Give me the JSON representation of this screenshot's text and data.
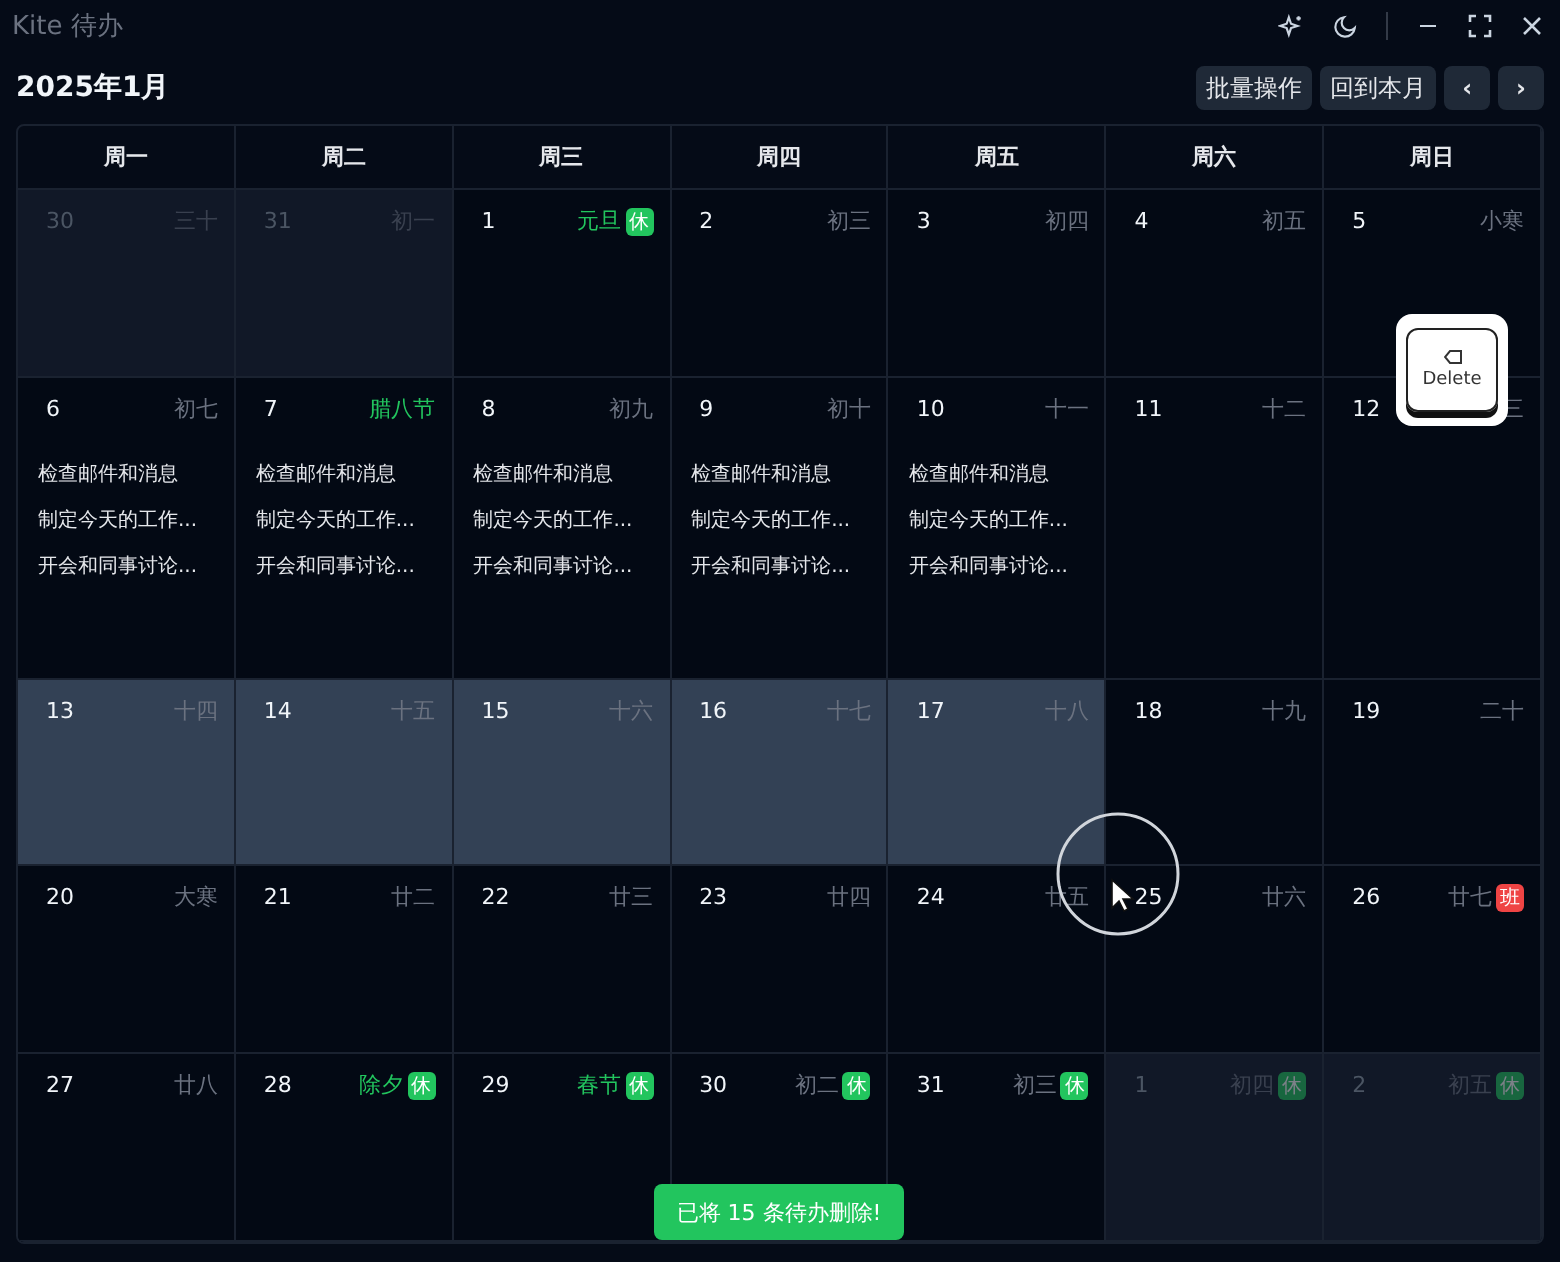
{
  "window": {
    "title": "Kite 待办"
  },
  "month_title": "2025年1月",
  "toolbar": [
    {
      "label": "批量操作",
      "kind": "text"
    },
    {
      "label": "回到本月",
      "kind": "text"
    },
    {
      "label": "‹",
      "kind": "icon"
    },
    {
      "label": "›",
      "kind": "icon"
    }
  ],
  "weekdays": [
    "周一",
    "周二",
    "周三",
    "周四",
    "周五",
    "周六",
    "周日"
  ],
  "weeks": [
    {
      "days": [
        {
          "day": "30",
          "lunar": "三十",
          "festival": false,
          "other_month": true,
          "selected": false
        },
        {
          "day": "31",
          "lunar": "初一",
          "festival": false,
          "other_month": true,
          "selected": false
        },
        {
          "day": "1",
          "lunar": "元旦",
          "festival": true,
          "badge": {
            "text": "休",
            "kind": "rest"
          },
          "other_month": false,
          "selected": false
        },
        {
          "day": "2",
          "lunar": "初三",
          "festival": false,
          "other_month": false,
          "selected": false
        },
        {
          "day": "3",
          "lunar": "初四",
          "festival": false,
          "other_month": false,
          "selected": false
        },
        {
          "day": "4",
          "lunar": "初五",
          "festival": false,
          "other_month": false,
          "selected": false
        },
        {
          "day": "5",
          "lunar": "小寒",
          "festival": false,
          "other_month": false,
          "selected": false
        }
      ]
    },
    {
      "days": [
        {
          "day": "6",
          "lunar": "初七",
          "festival": false,
          "other_month": false,
          "selected": false,
          "todos": [
            "检查邮件和消息",
            "制定今天的工作...",
            "开会和同事讨论..."
          ]
        },
        {
          "day": "7",
          "lunar": "腊八节",
          "festival": true,
          "other_month": false,
          "selected": false,
          "todos": [
            "检查邮件和消息",
            "制定今天的工作...",
            "开会和同事讨论..."
          ]
        },
        {
          "day": "8",
          "lunar": "初九",
          "festival": false,
          "other_month": false,
          "selected": false,
          "todos": [
            "检查邮件和消息",
            "制定今天的工作...",
            "开会和同事讨论..."
          ]
        },
        {
          "day": "9",
          "lunar": "初十",
          "festival": false,
          "other_month": false,
          "selected": false,
          "todos": [
            "检查邮件和消息",
            "制定今天的工作...",
            "开会和同事讨论..."
          ]
        },
        {
          "day": "10",
          "lunar": "十一",
          "festival": false,
          "other_month": false,
          "selected": false,
          "todos": [
            "检查邮件和消息",
            "制定今天的工作...",
            "开会和同事讨论..."
          ]
        },
        {
          "day": "11",
          "lunar": "十二",
          "festival": false,
          "other_month": false,
          "selected": false
        },
        {
          "day": "12",
          "lunar": "三",
          "festival": false,
          "other_month": false,
          "selected": false
        }
      ]
    },
    {
      "days": [
        {
          "day": "13",
          "lunar": "十四",
          "festival": false,
          "other_month": false,
          "selected": true
        },
        {
          "day": "14",
          "lunar": "十五",
          "festival": false,
          "other_month": false,
          "selected": true
        },
        {
          "day": "15",
          "lunar": "十六",
          "festival": false,
          "other_month": false,
          "selected": true
        },
        {
          "day": "16",
          "lunar": "十七",
          "festival": false,
          "other_month": false,
          "selected": true
        },
        {
          "day": "17",
          "lunar": "十八",
          "festival": false,
          "other_month": false,
          "selected": true
        },
        {
          "day": "18",
          "lunar": "十九",
          "festival": false,
          "other_month": false,
          "selected": false
        },
        {
          "day": "19",
          "lunar": "二十",
          "festival": false,
          "other_month": false,
          "selected": false
        }
      ]
    },
    {
      "days": [
        {
          "day": "20",
          "lunar": "大寒",
          "festival": false,
          "other_month": false,
          "selected": false
        },
        {
          "day": "21",
          "lunar": "廿二",
          "festival": false,
          "other_month": false,
          "selected": false
        },
        {
          "day": "22",
          "lunar": "廿三",
          "festival": false,
          "other_month": false,
          "selected": false
        },
        {
          "day": "23",
          "lunar": "廿四",
          "festival": false,
          "other_month": false,
          "selected": false
        },
        {
          "day": "24",
          "lunar": "廿五",
          "festival": false,
          "other_month": false,
          "selected": false
        },
        {
          "day": "25",
          "lunar": "廿六",
          "festival": false,
          "other_month": false,
          "selected": false
        },
        {
          "day": "26",
          "lunar": "廿七",
          "festival": false,
          "badge": {
            "text": "班",
            "kind": "work"
          },
          "other_month": false,
          "selected": false
        }
      ]
    },
    {
      "days": [
        {
          "day": "27",
          "lunar": "廿八",
          "festival": false,
          "other_month": false,
          "selected": false
        },
        {
          "day": "28",
          "lunar": "除夕",
          "festival": true,
          "badge": {
            "text": "休",
            "kind": "rest"
          },
          "other_month": false,
          "selected": false
        },
        {
          "day": "29",
          "lunar": "春节",
          "festival": true,
          "badge": {
            "text": "休",
            "kind": "rest"
          },
          "other_month": false,
          "selected": false
        },
        {
          "day": "30",
          "lunar": "初二",
          "festival": false,
          "badge": {
            "text": "休",
            "kind": "rest"
          },
          "other_month": false,
          "selected": false
        },
        {
          "day": "31",
          "lunar": "初三",
          "festival": false,
          "badge": {
            "text": "休",
            "kind": "rest"
          },
          "other_month": false,
          "selected": false
        },
        {
          "day": "1",
          "lunar": "初四",
          "festival": false,
          "badge": {
            "text": "休",
            "kind": "rest"
          },
          "other_month": true,
          "selected": false
        },
        {
          "day": "2",
          "lunar": "初五",
          "festival": false,
          "badge": {
            "text": "休",
            "kind": "rest"
          },
          "other_month": true,
          "selected": false
        }
      ]
    }
  ],
  "key_overlay": {
    "label": "Delete"
  },
  "toast": "已将 15 条待办删除!"
}
